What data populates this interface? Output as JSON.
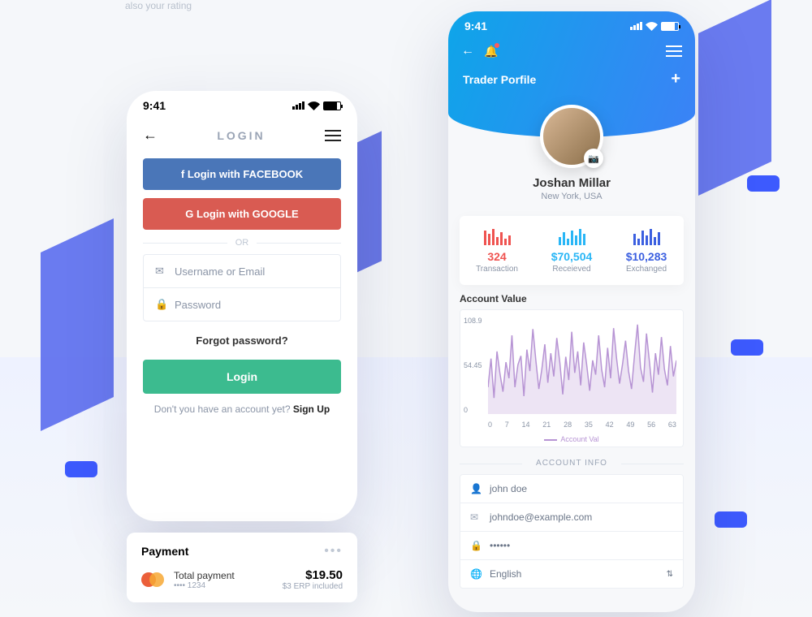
{
  "caption": "also your rating",
  "statusbar": {
    "time": "9:41"
  },
  "login": {
    "title": "LOGIN",
    "facebook": "Login with FACEBOOK",
    "google": "Login with GOOGLE",
    "or": "OR",
    "username_ph": "Username or Email",
    "password_ph": "Password",
    "forgot": "Forgot password?",
    "button": "Login",
    "signup_prompt": "Don't you have an account yet? ",
    "signup_action": "Sign Up"
  },
  "payment": {
    "heading": "Payment",
    "total_label": "Total payment",
    "card_mask": "•••• 1234",
    "amount": "$19.50",
    "sub": "$3 ERP included"
  },
  "profile": {
    "header_title": "Trader Porfile",
    "name": "Joshan Millar",
    "location": "New York, USA",
    "stats": [
      {
        "value": "324",
        "label": "Transaction"
      },
      {
        "value": "$70,504",
        "label": "Receieved"
      },
      {
        "value": "$10,283",
        "label": "Exchanged"
      }
    ],
    "chart_title": "Account Value",
    "chart_legend": "Account Val",
    "account_info_heading": "ACCOUNT INFO",
    "fields": {
      "name": "john doe",
      "email": "johndoe@example.com",
      "password": "••••••",
      "language": "English"
    }
  },
  "chart_data": {
    "type": "line",
    "title": "Account Value",
    "xlabel": "",
    "ylabel": "",
    "ylim": [
      0,
      108.9
    ],
    "y_ticks": [
      "108.9",
      "54.45",
      "0"
    ],
    "x_ticks": [
      "0",
      "7",
      "14",
      "21",
      "28",
      "35",
      "42",
      "49",
      "56",
      "63"
    ],
    "series": [
      {
        "name": "Account Val",
        "color": "#b794d4",
        "x": [
          0,
          1,
          2,
          3,
          4,
          5,
          6,
          7,
          8,
          9,
          10,
          11,
          12,
          13,
          14,
          15,
          16,
          17,
          18,
          19,
          20,
          21,
          22,
          23,
          24,
          25,
          26,
          27,
          28,
          29,
          30,
          31,
          32,
          33,
          34,
          35,
          36,
          37,
          38,
          39,
          40,
          41,
          42,
          43,
          44,
          45,
          46,
          47,
          48,
          49,
          50,
          51,
          52,
          53,
          54,
          55,
          56,
          57,
          58,
          59,
          60,
          61,
          62,
          63
        ],
        "values": [
          30,
          62,
          18,
          70,
          45,
          25,
          58,
          40,
          88,
          30,
          55,
          65,
          20,
          72,
          48,
          95,
          60,
          28,
          50,
          78,
          35,
          68,
          42,
          85,
          58,
          22,
          64,
          38,
          92,
          46,
          70,
          32,
          80,
          55,
          26,
          60,
          44,
          88,
          50,
          30,
          74,
          40,
          96,
          62,
          34,
          56,
          82,
          48,
          28,
          66,
          100,
          52,
          36,
          90,
          58,
          24,
          68,
          44,
          86,
          50,
          32,
          76,
          42,
          60
        ]
      }
    ]
  }
}
